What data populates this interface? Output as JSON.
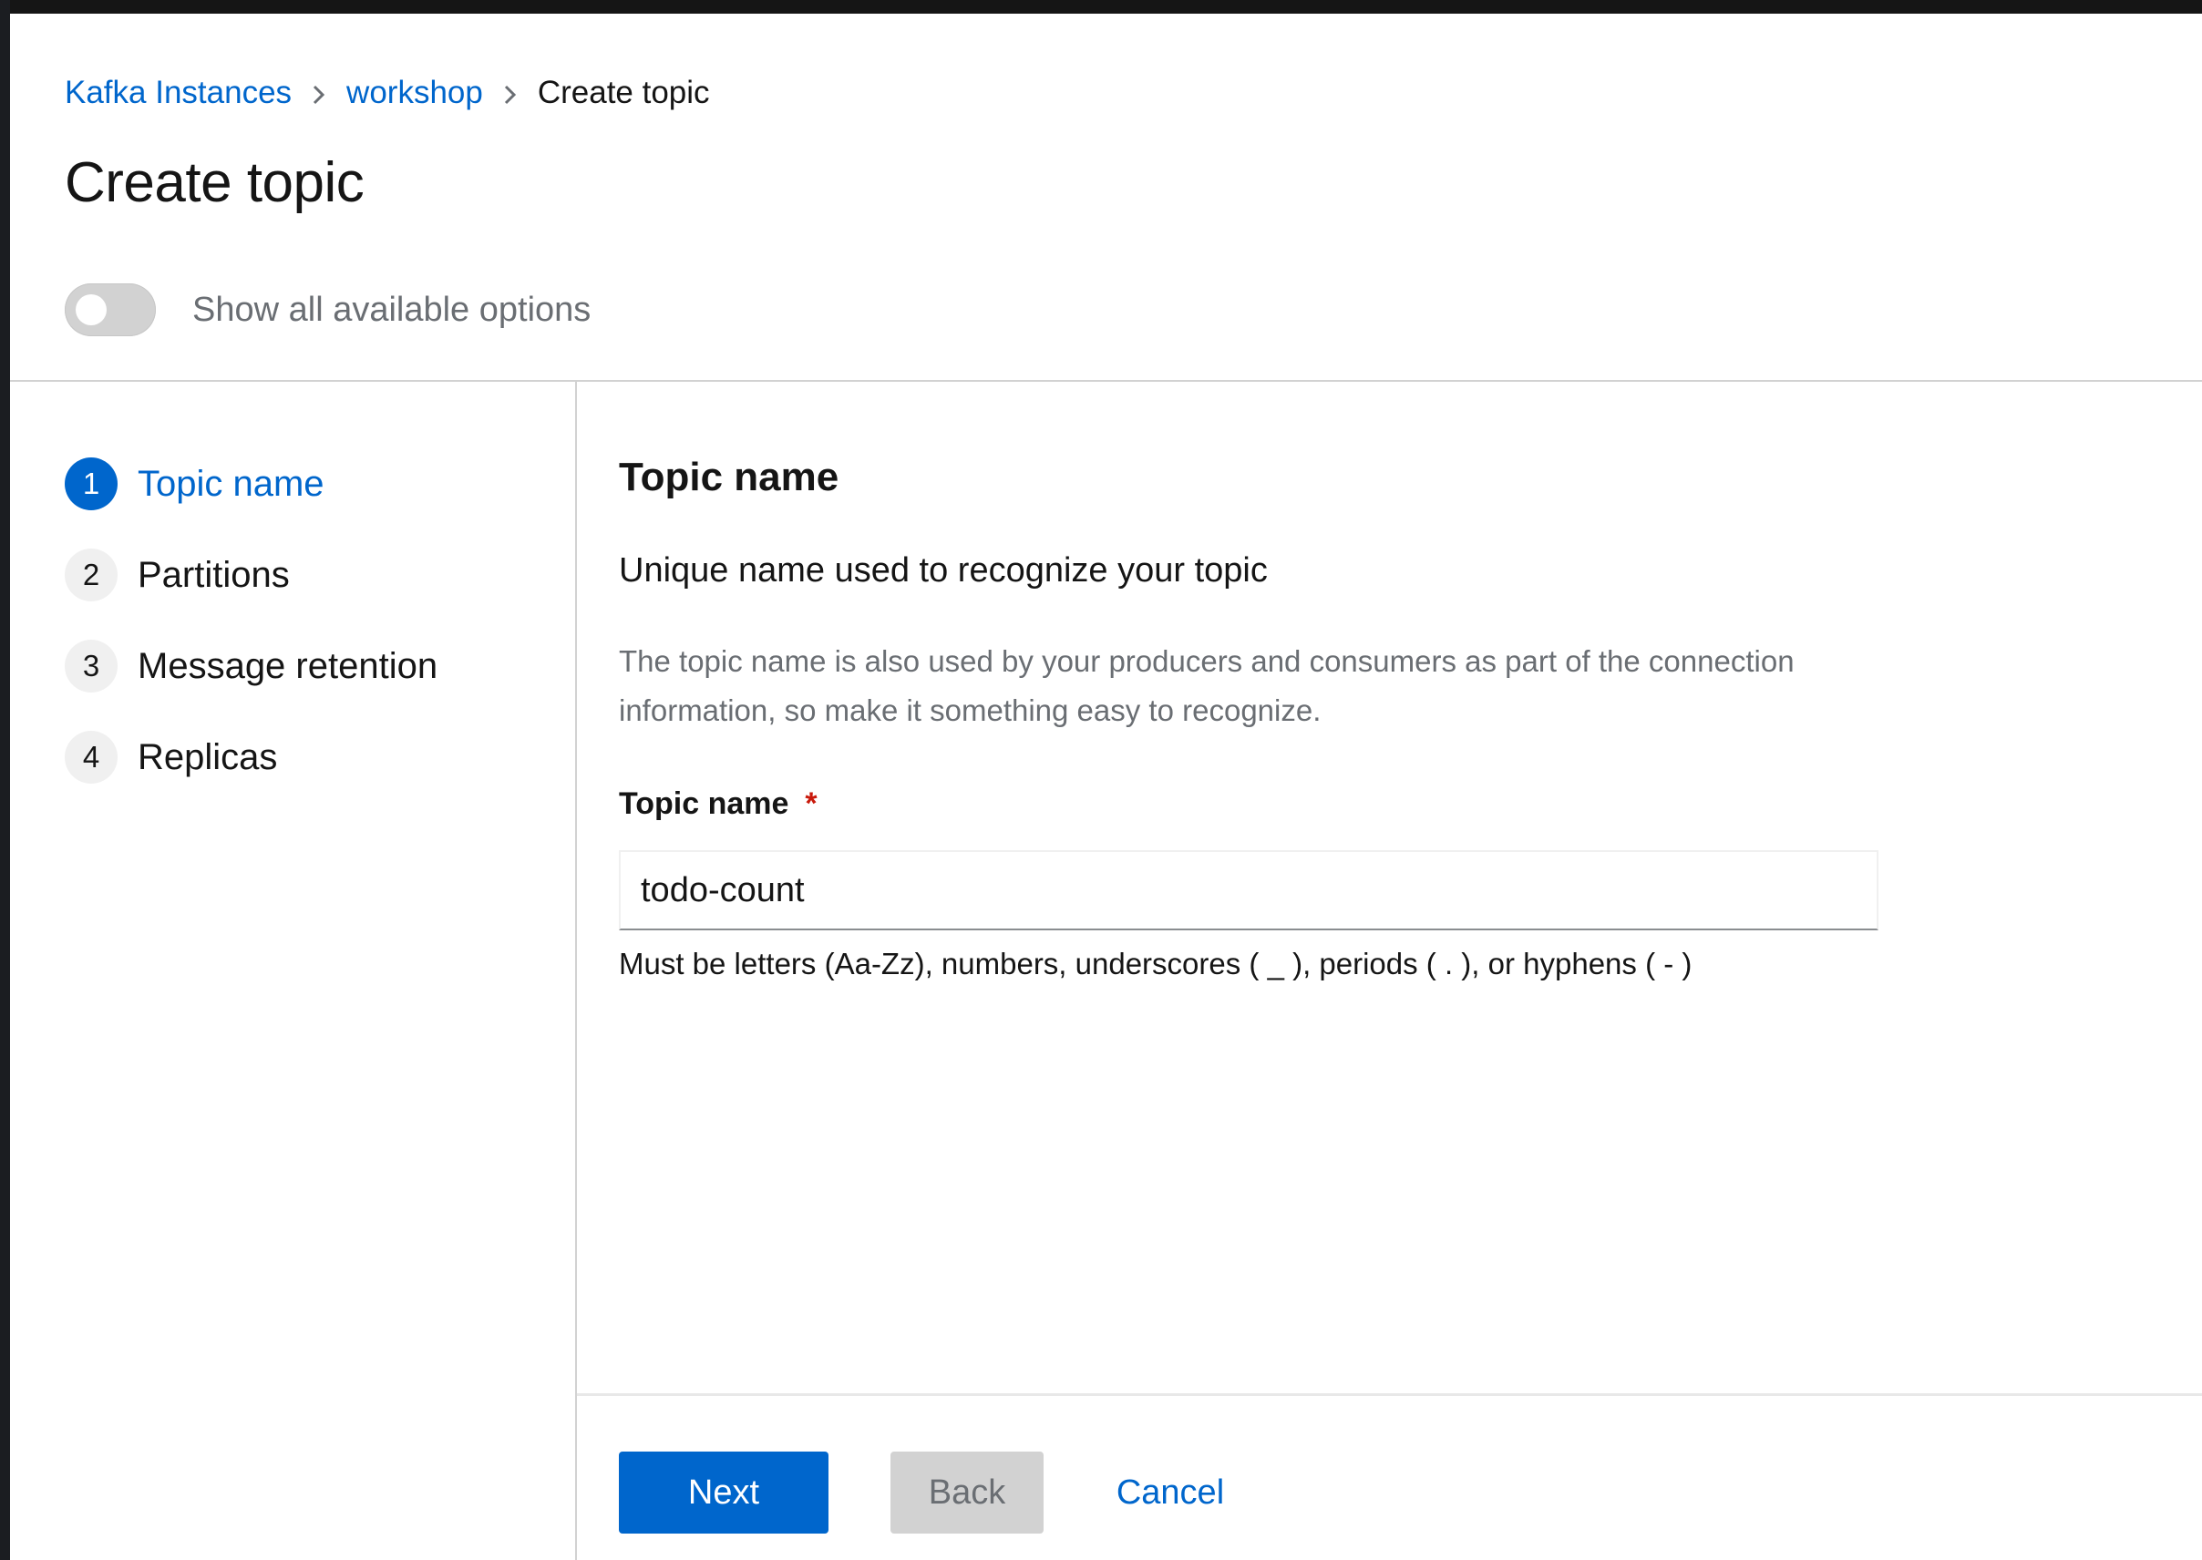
{
  "breadcrumb": {
    "items": [
      {
        "label": "Kafka Instances"
      },
      {
        "label": "workshop"
      },
      {
        "label": "Create topic"
      }
    ]
  },
  "page": {
    "title": "Create topic"
  },
  "options_toggle": {
    "label": "Show all available options",
    "checked": false
  },
  "wizard": {
    "steps": [
      {
        "number": "1",
        "label": "Topic name",
        "active": true
      },
      {
        "number": "2",
        "label": "Partitions",
        "active": false
      },
      {
        "number": "3",
        "label": "Message retention",
        "active": false
      },
      {
        "number": "4",
        "label": "Replicas",
        "active": false
      }
    ]
  },
  "step": {
    "title": "Topic name",
    "subtitle": "Unique name used to recognize your topic",
    "description_line1": "The topic name is also used by your producers and consumers as part of the connection",
    "description_line2": "information, so make it something easy to recognize.",
    "field_label": "Topic name",
    "required_mark": "*",
    "field_value": "todo-count",
    "helper": "Must be letters (Aa-Zz), numbers, underscores ( _ ), periods ( . ), or hyphens ( - )"
  },
  "footer": {
    "next_label": "Next",
    "back_label": "Back",
    "cancel_label": "Cancel"
  },
  "colors": {
    "accent": "#0066cc",
    "required": "#c9190b",
    "disabled_bg": "#d2d2d2"
  }
}
